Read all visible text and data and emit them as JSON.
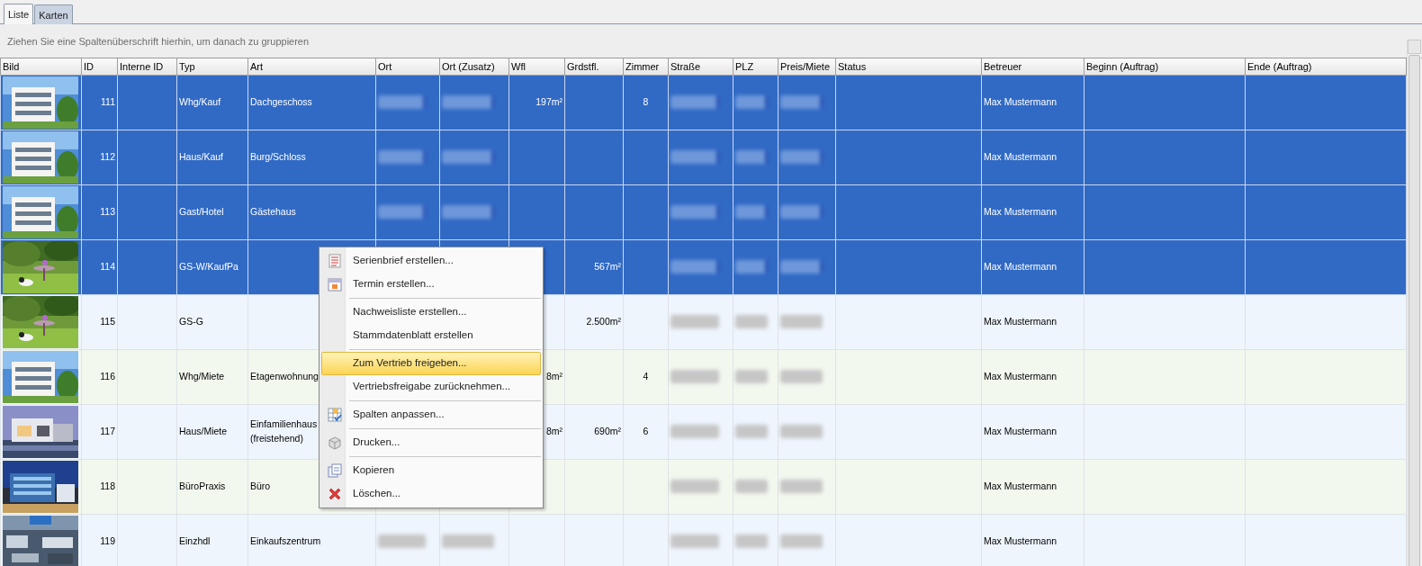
{
  "tabs": [
    {
      "label": "Liste",
      "selected": true
    },
    {
      "label": "Karten",
      "selected": false
    }
  ],
  "group_panel": {
    "hint": "Ziehen Sie eine Spaltenüberschrift hierhin, um danach zu gruppieren"
  },
  "table": {
    "columns": [
      "Bild",
      "ID",
      "Interne ID",
      "Typ",
      "Art",
      "Ort",
      "Ort (Zusatz)",
      "Wfl",
      "Grdstfl.",
      "Zimmer",
      "Straße",
      "PLZ",
      "Preis/Miete",
      "Status",
      "Betreuer",
      "Beginn (Auftrag)",
      "Ende (Auftrag)"
    ],
    "rows": [
      {
        "selected": true,
        "cells": [
          {
            "kind": "picture"
          },
          "111",
          null,
          "Whg/Kauf",
          "Dachgeschoss",
          {
            "kind": "blurred"
          },
          {
            "kind": "blurred"
          },
          "197m²",
          null,
          "8",
          {
            "kind": "blurred"
          },
          {
            "kind": "blurred"
          },
          {
            "kind": "blurred"
          },
          null,
          "Max Mustermann",
          null,
          null
        ]
      },
      {
        "selected": true,
        "cells": [
          {
            "kind": "picture"
          },
          "112",
          null,
          "Haus/Kauf",
          "Burg/Schloss",
          {
            "kind": "blurred"
          },
          {
            "kind": "blurred"
          },
          null,
          null,
          null,
          {
            "kind": "blurred"
          },
          {
            "kind": "blurred"
          },
          {
            "kind": "blurred"
          },
          null,
          "Max Mustermann",
          null,
          null
        ]
      },
      {
        "selected": true,
        "cells": [
          {
            "kind": "picture"
          },
          "113",
          null,
          "Gast/Hotel",
          "Gästehaus",
          {
            "kind": "blurred"
          },
          {
            "kind": "blurred"
          },
          null,
          null,
          null,
          {
            "kind": "blurred"
          },
          {
            "kind": "blurred"
          },
          {
            "kind": "blurred"
          },
          null,
          "Max Mustermann",
          null,
          null
        ]
      },
      {
        "selected": true,
        "cells": [
          {
            "kind": "picture"
          },
          "114",
          null,
          "GS-W/KaufPa",
          null,
          null,
          null,
          null,
          "567m²",
          null,
          {
            "kind": "blurred"
          },
          {
            "kind": "blurred"
          },
          {
            "kind": "blurred"
          },
          null,
          "Max Mustermann",
          null,
          null
        ]
      },
      {
        "selected": false,
        "cells": [
          {
            "kind": "picture"
          },
          "115",
          null,
          "GS-G",
          null,
          null,
          null,
          null,
          "2.500m²",
          null,
          {
            "kind": "blurred"
          },
          {
            "kind": "blurred"
          },
          {
            "kind": "blurred"
          },
          null,
          "Max Mustermann",
          null,
          null
        ]
      },
      {
        "selected": false,
        "cells": [
          {
            "kind": "picture"
          },
          "116",
          null,
          "Whg/Miete",
          "Etagenwohnung",
          null,
          null,
          "8m²",
          null,
          "4",
          {
            "kind": "blurred"
          },
          {
            "kind": "blurred"
          },
          {
            "kind": "blurred"
          },
          null,
          "Max Mustermann",
          null,
          null
        ]
      },
      {
        "selected": false,
        "cells": [
          {
            "kind": "picture"
          },
          "117",
          null,
          "Haus/Miete",
          "Einfamilienhaus\n(freistehend)",
          null,
          null,
          "8m²",
          "690m²",
          "6",
          {
            "kind": "blurred"
          },
          {
            "kind": "blurred"
          },
          {
            "kind": "blurred"
          },
          null,
          "Max Mustermann",
          null,
          null
        ]
      },
      {
        "selected": false,
        "cells": [
          {
            "kind": "picture"
          },
          "118",
          null,
          "BüroPraxis",
          "Büro",
          null,
          null,
          null,
          null,
          null,
          {
            "kind": "blurred"
          },
          {
            "kind": "blurred"
          },
          {
            "kind": "blurred"
          },
          null,
          "Max Mustermann",
          null,
          null
        ]
      },
      {
        "selected": false,
        "cells": [
          {
            "kind": "picture"
          },
          "119",
          null,
          "Einzhdl",
          "Einkaufszentrum",
          {
            "kind": "blurred"
          },
          {
            "kind": "blurred"
          },
          null,
          null,
          null,
          {
            "kind": "blurred"
          },
          {
            "kind": "blurred"
          },
          {
            "kind": "blurred"
          },
          null,
          "Max Mustermann",
          null,
          null
        ]
      }
    ]
  },
  "context_menu": {
    "groups": [
      [
        {
          "label": "Serienbrief erstellen...",
          "selected": false
        },
        {
          "label": "Termin erstellen...",
          "selected": false
        }
      ],
      [
        {
          "label": "Nachweisliste erstellen...",
          "selected": false
        },
        {
          "label": "Stammdatenblatt erstellen",
          "selected": false
        }
      ],
      [
        {
          "label": "Zum Vertrieb freigeben...",
          "selected": true
        },
        {
          "label": "Vertriebsfreigabe zurücknehmen...",
          "selected": false
        }
      ],
      [
        {
          "label": "Spalten anpassen...",
          "selected": false
        }
      ],
      [
        {
          "label": "Drucken...",
          "selected": false
        }
      ],
      [
        {
          "label": "Kopieren",
          "selected": false
        },
        {
          "label": "Löschen...",
          "selected": false
        }
      ]
    ]
  }
}
